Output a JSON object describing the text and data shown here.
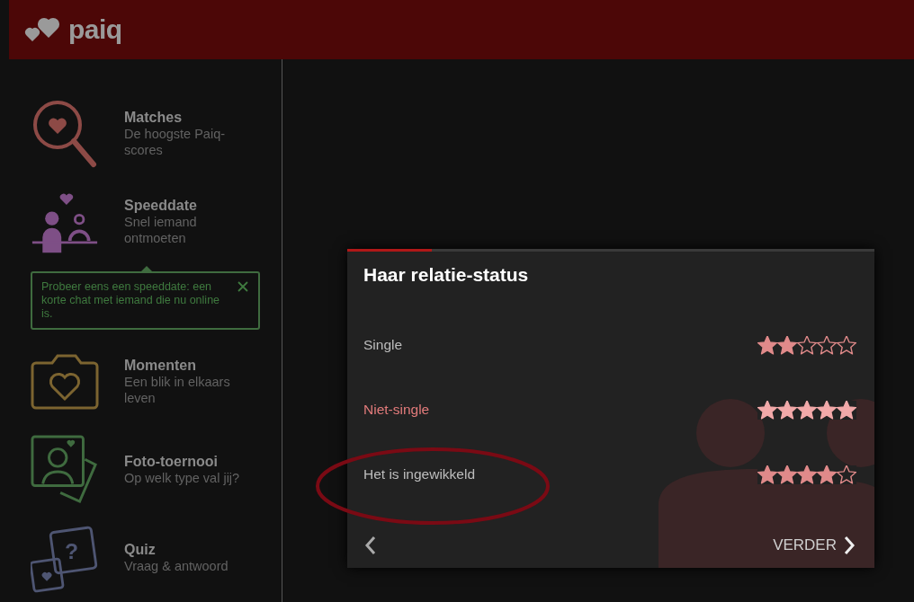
{
  "header": {
    "logo": "paiq"
  },
  "sidebar": {
    "items": [
      {
        "title": "Matches",
        "subtitle": "De hoogste Paiq-scores"
      },
      {
        "title": "Speeddate",
        "subtitle": "Snel iemand ontmoeten",
        "tip": "Probeer eens een speeddate: een korte chat met iemand die nu online is."
      },
      {
        "title": "Momenten",
        "subtitle": "Een blik in elkaars leven"
      },
      {
        "title": "Foto-toernooi",
        "subtitle": "Op welk type val jij?"
      },
      {
        "title": "Quiz",
        "subtitle": "Vraag & antwoord",
        "icon_mark": "?"
      }
    ]
  },
  "card": {
    "progress": {
      "level": 0.16
    },
    "title": "Haar relatie-status",
    "options": [
      {
        "label": "Single",
        "selected": false,
        "stars": 2
      },
      {
        "label": "Niet-single",
        "selected": true,
        "stars": 5
      },
      {
        "label": "Het is ingewikkeld",
        "selected": false,
        "stars": 4
      }
    ],
    "next": "VERDER"
  }
}
